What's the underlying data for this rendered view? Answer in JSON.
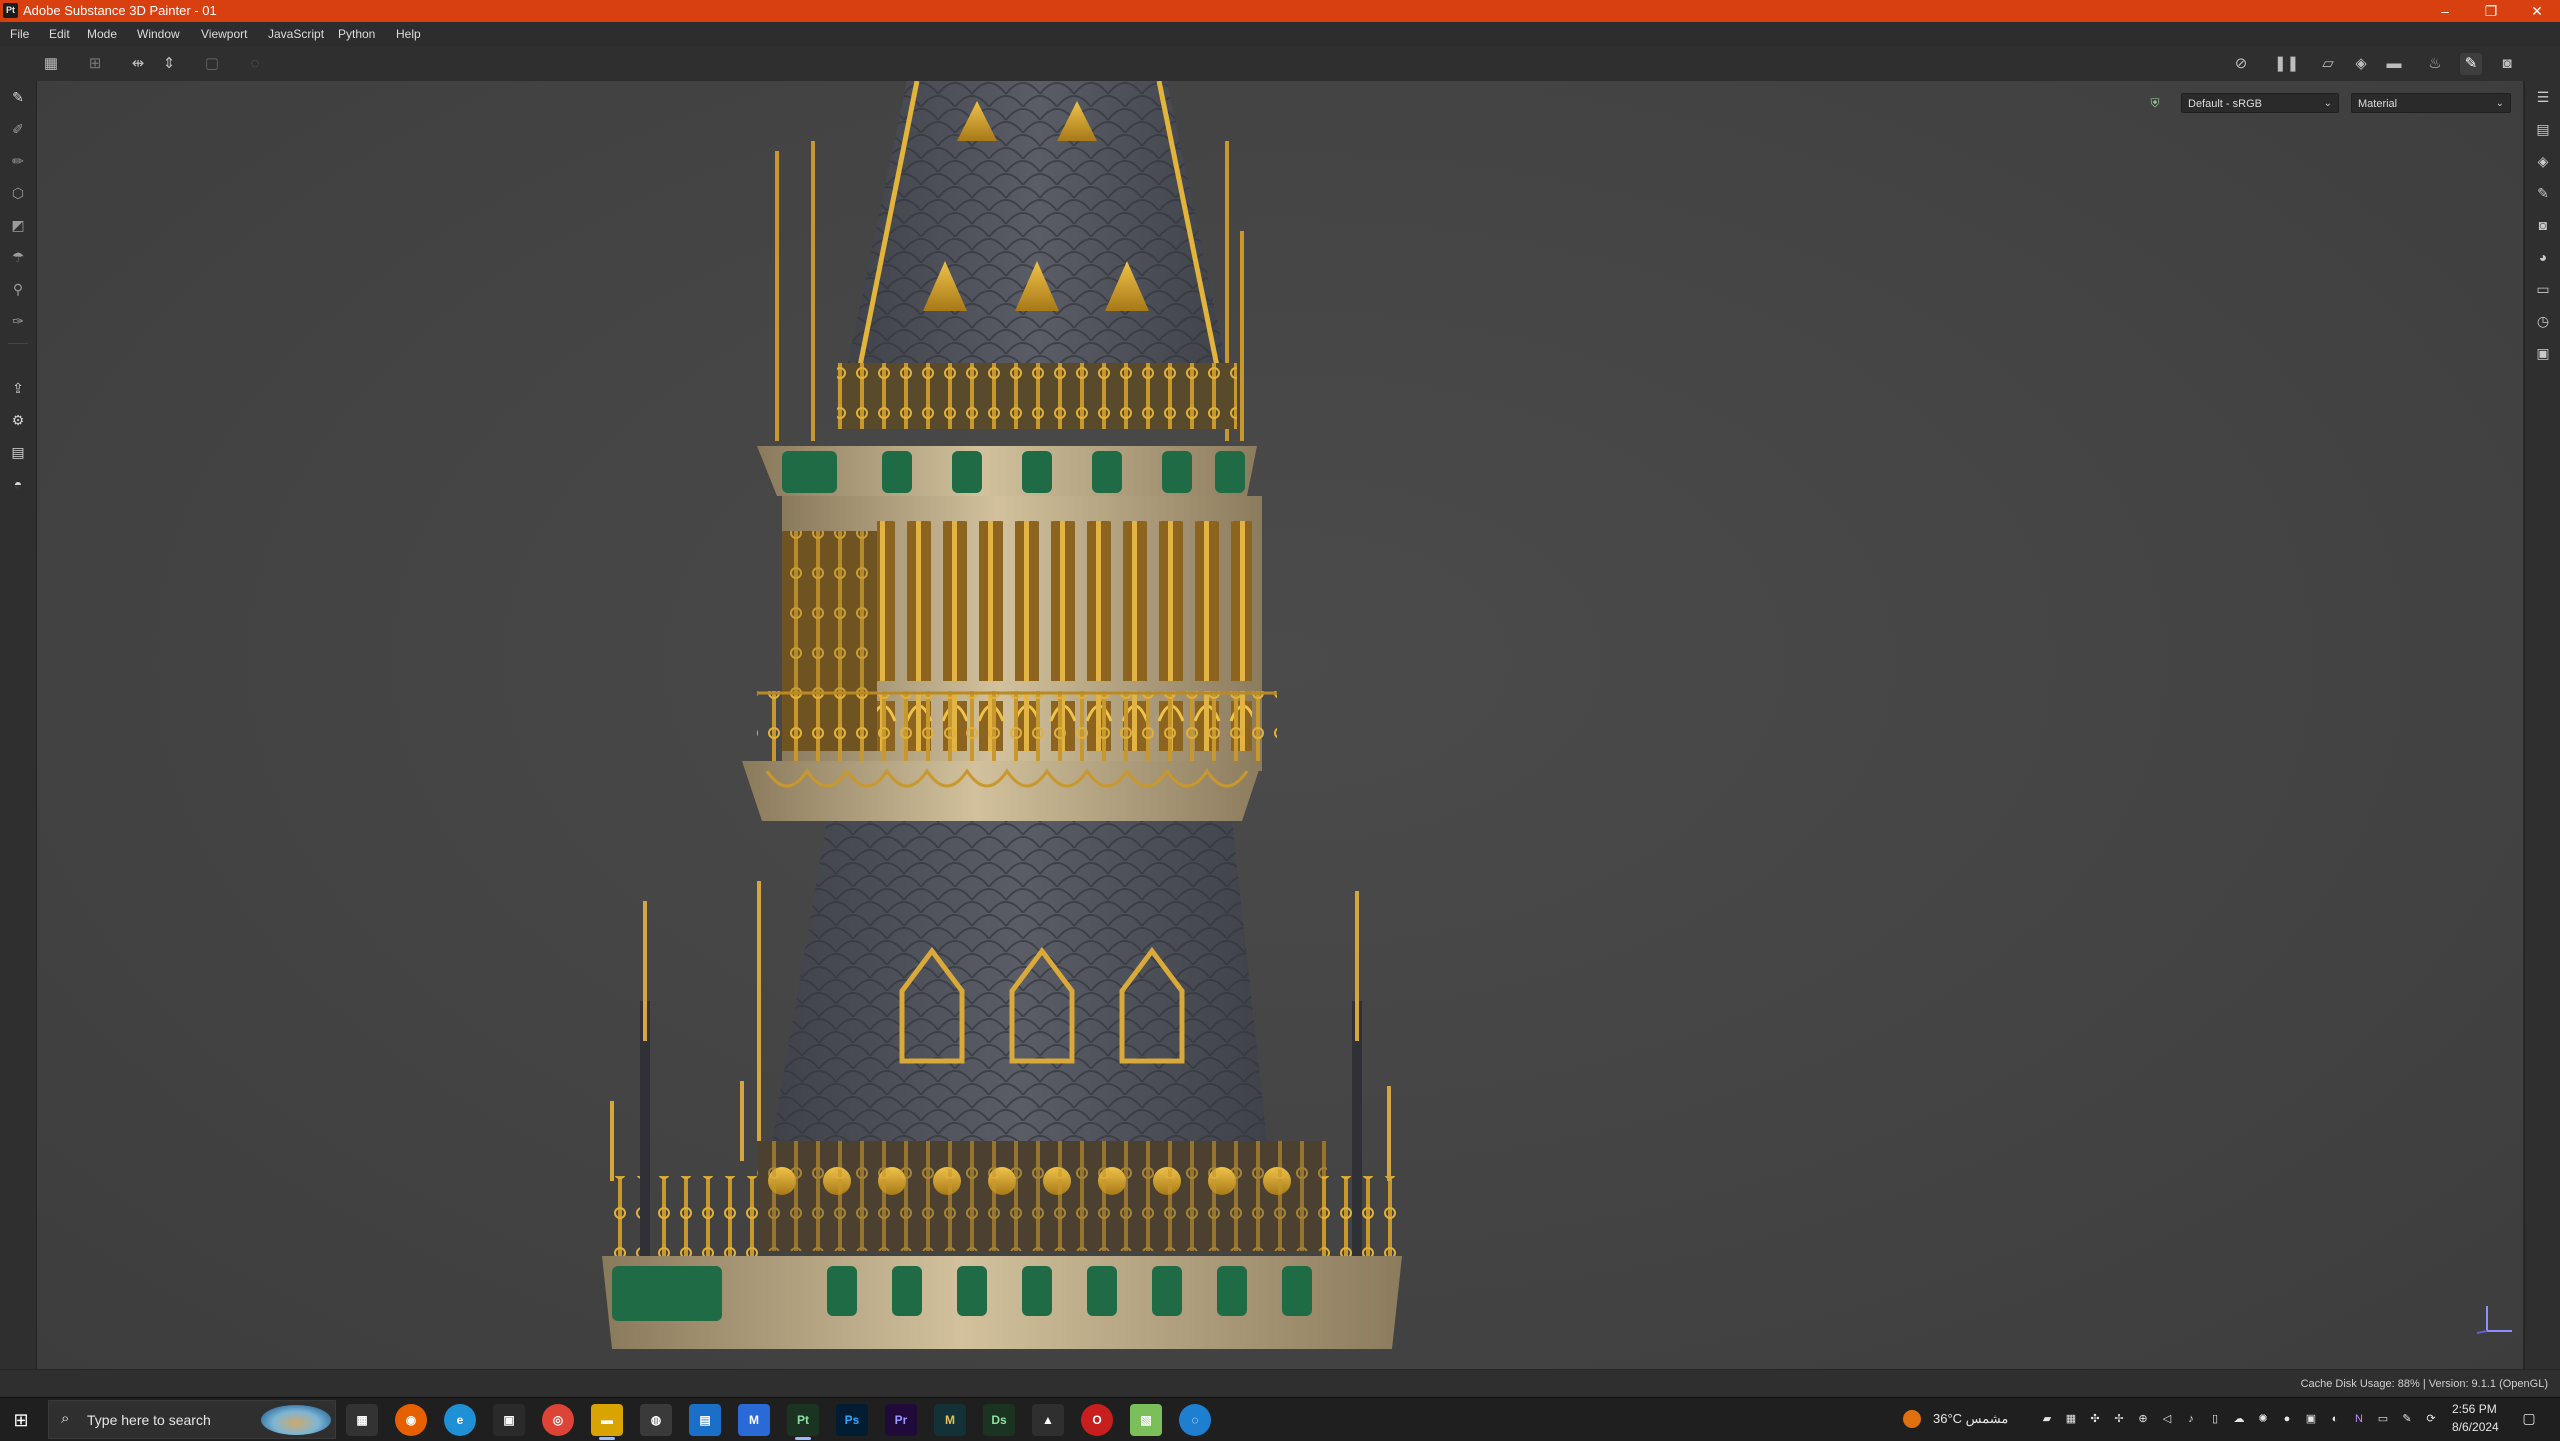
{
  "window": {
    "title": "Adobe Substance 3D Painter - 01",
    "app_badge": "Pt",
    "controls": [
      "–",
      "❐",
      "✕"
    ]
  },
  "menu": [
    "File",
    "Edit",
    "Mode",
    "Window",
    "Viewport",
    "JavaScript",
    "Python",
    "Help"
  ],
  "toolbar": {
    "left_icons": [
      "grid-icon",
      "grid-dots-icon",
      "symmetry-x-icon",
      "symmetry-y-icon",
      "frame-icon",
      "history-circle-icon"
    ],
    "right_icons": [
      "hide-icon",
      "pause-icon",
      "uv-view-icon",
      "cube-icon",
      "camera-icon",
      "brush-shape-icon",
      "paint-brush-icon",
      "screenshot-icon"
    ]
  },
  "viewport": {
    "color_space": "Default - sRGB",
    "display_mode": "Material",
    "colors": {
      "background": "#464646",
      "gold": "#c79a2b",
      "slate": "#55585f",
      "stone": "#c8b896",
      "green": "#1f6b45"
    }
  },
  "left_tools": [
    "paint-brush-icon",
    "eraser-icon",
    "projection-icon",
    "geometry-mask-icon",
    "polygon-fill-icon",
    "smudge-icon",
    "clone-stamp-icon",
    "color-picker-icon",
    "export-icon",
    "bake-icon",
    "document-icon",
    "material-icon"
  ],
  "right_panels": [
    "layers-panel-icon",
    "texture-set-icon",
    "layer-stack-icon",
    "properties-icon",
    "display-settings-icon",
    "shader-icon",
    "assets-icon",
    "history-icon",
    "log-icon"
  ],
  "status": {
    "text": "Cache Disk Usage:  88% | Version: 9.1.1 (OpenGL)"
  },
  "taskbar": {
    "search_placeholder": "Type here to search",
    "apps": [
      {
        "name": "clapper-app",
        "label": "▦",
        "color": "#3a3a3a"
      },
      {
        "name": "firefox",
        "label": "◉",
        "color": "#e66000"
      },
      {
        "name": "edge",
        "label": "e",
        "color": "#1f8fd6"
      },
      {
        "name": "store",
        "label": "▣",
        "color": "#2a2a2a"
      },
      {
        "name": "chrome",
        "label": "◎",
        "color": "#db4437"
      },
      {
        "name": "file-explorer",
        "label": "▬",
        "color": "#d9a400"
      },
      {
        "name": "camera-app",
        "label": "◍",
        "color": "#3a3a3a"
      },
      {
        "name": "blue-app",
        "label": "▤",
        "color": "#1a6fc9"
      },
      {
        "name": "m-app",
        "label": "M",
        "color": "#2a6ad6"
      },
      {
        "name": "substance-painter",
        "label": "Pt",
        "color": "#1b3321"
      },
      {
        "name": "photoshop",
        "label": "Ps",
        "color": "#001d34"
      },
      {
        "name": "premiere",
        "label": "Pr",
        "color": "#1f0a3a"
      },
      {
        "name": "maya",
        "label": "M",
        "color": "#133237"
      },
      {
        "name": "substance-designer",
        "label": "Ds",
        "color": "#1b3321"
      },
      {
        "name": "photos-app",
        "label": "▲",
        "color": "#2f2f2f"
      },
      {
        "name": "opera",
        "label": "O",
        "color": "#c81e1e"
      },
      {
        "name": "image-app",
        "label": "▧",
        "color": "#7bbf5a"
      },
      {
        "name": "settings-app",
        "label": "◌",
        "color": "#1e7fd1"
      }
    ],
    "weather": "36°C  مشمس",
    "time": "2:56 PM",
    "date": "8/6/2024"
  }
}
